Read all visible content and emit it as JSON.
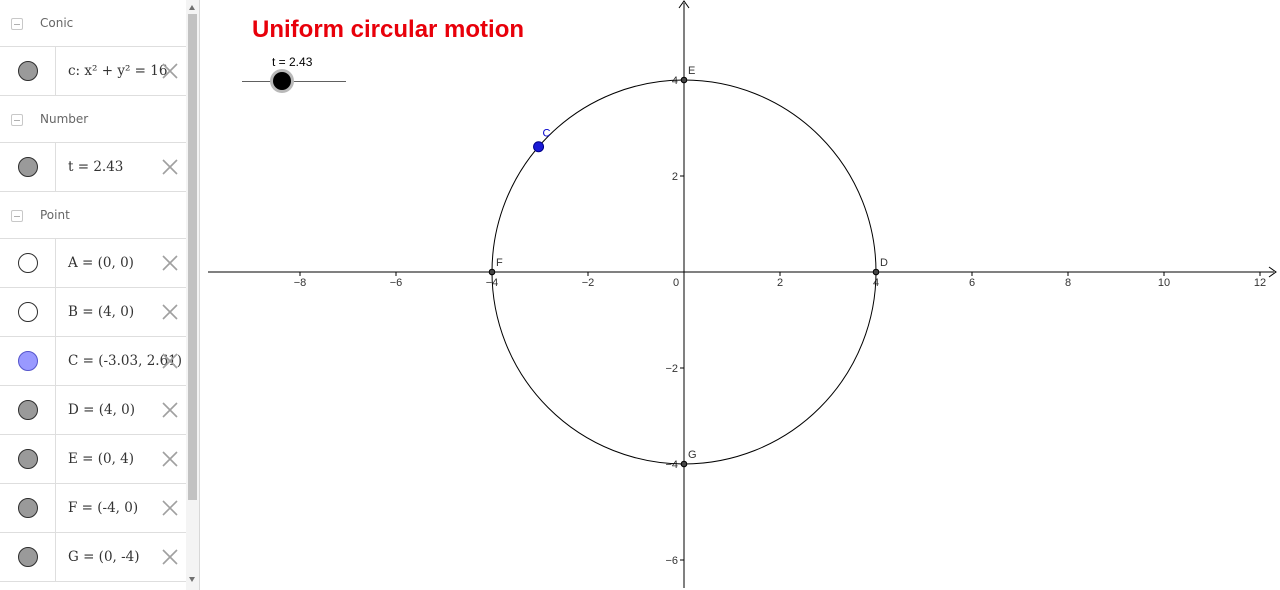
{
  "algebra": {
    "groups": [
      {
        "title": "Conic",
        "items": [
          {
            "expr": "c: x² + y² = 16",
            "marble": "shown"
          }
        ]
      },
      {
        "title": "Number",
        "items": [
          {
            "expr": "t = 2.43",
            "marble": "shown"
          }
        ]
      },
      {
        "title": "Point",
        "items": [
          {
            "expr": "A = (0, 0)",
            "marble": "hidden"
          },
          {
            "expr": "B = (4, 0)",
            "marble": "hidden"
          },
          {
            "expr": "C = (-3.03, 2.61)",
            "marble": "accent"
          },
          {
            "expr": "D = (4, 0)",
            "marble": "shown"
          },
          {
            "expr": "E = (0, 4)",
            "marble": "shown"
          },
          {
            "expr": "F = (-4, 0)",
            "marble": "shown"
          },
          {
            "expr": "G = (0, -4)",
            "marble": "shown"
          }
        ]
      }
    ],
    "delete_icon": "close-icon"
  },
  "graphics": {
    "title": "Uniform circular motion",
    "title_color": "#e8000a",
    "slider": {
      "label": "t = 2.43",
      "value": 2.43,
      "min": 0,
      "max": 6.28
    },
    "axes": {
      "x_ticks": [
        "−8",
        "−6",
        "−4",
        "−2",
        "0",
        "2",
        "4",
        "6",
        "8",
        "10",
        "12"
      ],
      "x_tick_values": [
        -8,
        -6,
        -4,
        -2,
        0,
        2,
        4,
        6,
        8,
        10,
        12
      ],
      "y_ticks": [
        "4",
        "2",
        "−2",
        "−4",
        "−6"
      ],
      "y_tick_values": [
        4,
        2,
        -2,
        -4,
        -6
      ]
    },
    "circle": {
      "cx": 0,
      "cy": 0,
      "r": 4
    },
    "points": [
      {
        "name": "E",
        "x": 0,
        "y": 4,
        "color": "#333333"
      },
      {
        "name": "F",
        "x": -4,
        "y": 0,
        "color": "#333333"
      },
      {
        "name": "D",
        "x": 4,
        "y": 0,
        "color": "#333333"
      },
      {
        "name": "G",
        "x": 0,
        "y": -4,
        "color": "#333333"
      },
      {
        "name": "C",
        "x": -3.03,
        "y": 2.61,
        "color": "#0000cc"
      }
    ]
  }
}
